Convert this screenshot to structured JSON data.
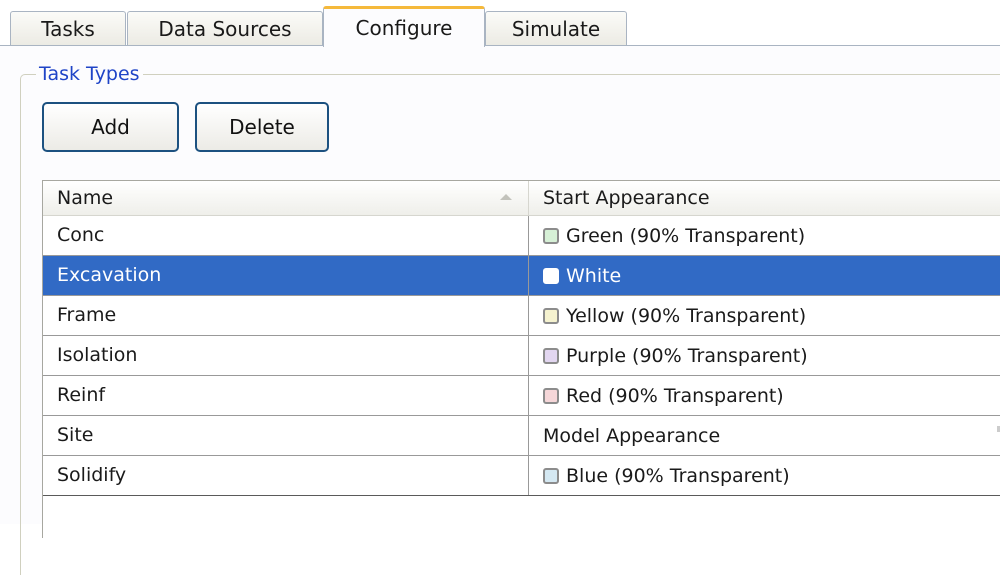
{
  "tabs": [
    {
      "label": "Tasks"
    },
    {
      "label": "Data Sources"
    },
    {
      "label": "Configure",
      "active": true
    },
    {
      "label": "Simulate"
    }
  ],
  "group": {
    "title": "Task Types"
  },
  "buttons": {
    "add": "Add",
    "delete": "Delete"
  },
  "grid": {
    "columns": {
      "name": "Name",
      "start_appearance": "Start Appearance"
    },
    "sort_indicator": "ascending",
    "rows": [
      {
        "name": "Conc",
        "appearance": "Green (90% Transparent)",
        "swatch": "#d6f0d6",
        "selected": false
      },
      {
        "name": "Excavation",
        "appearance": "White",
        "swatch": "#ffffff",
        "selected": true
      },
      {
        "name": "Frame",
        "appearance": "Yellow (90% Transparent)",
        "swatch": "#f5f2cf",
        "selected": false
      },
      {
        "name": "Isolation",
        "appearance": "Purple (90% Transparent)",
        "swatch": "#e2d6f0",
        "selected": false
      },
      {
        "name": "Reinf",
        "appearance": "Red (90% Transparent)",
        "swatch": "#f5d6d8",
        "selected": false
      },
      {
        "name": "Site",
        "appearance": "Model Appearance",
        "swatch": null,
        "selected": false
      },
      {
        "name": "Solidify",
        "appearance": "Blue (90% Transparent)",
        "swatch": "#d4e8f2",
        "selected": false
      }
    ]
  },
  "colors": {
    "selection": "#316ac5",
    "active_tab_accent": "#f5b93b",
    "group_title": "#1f44c7",
    "button_border": "#1c5180"
  }
}
